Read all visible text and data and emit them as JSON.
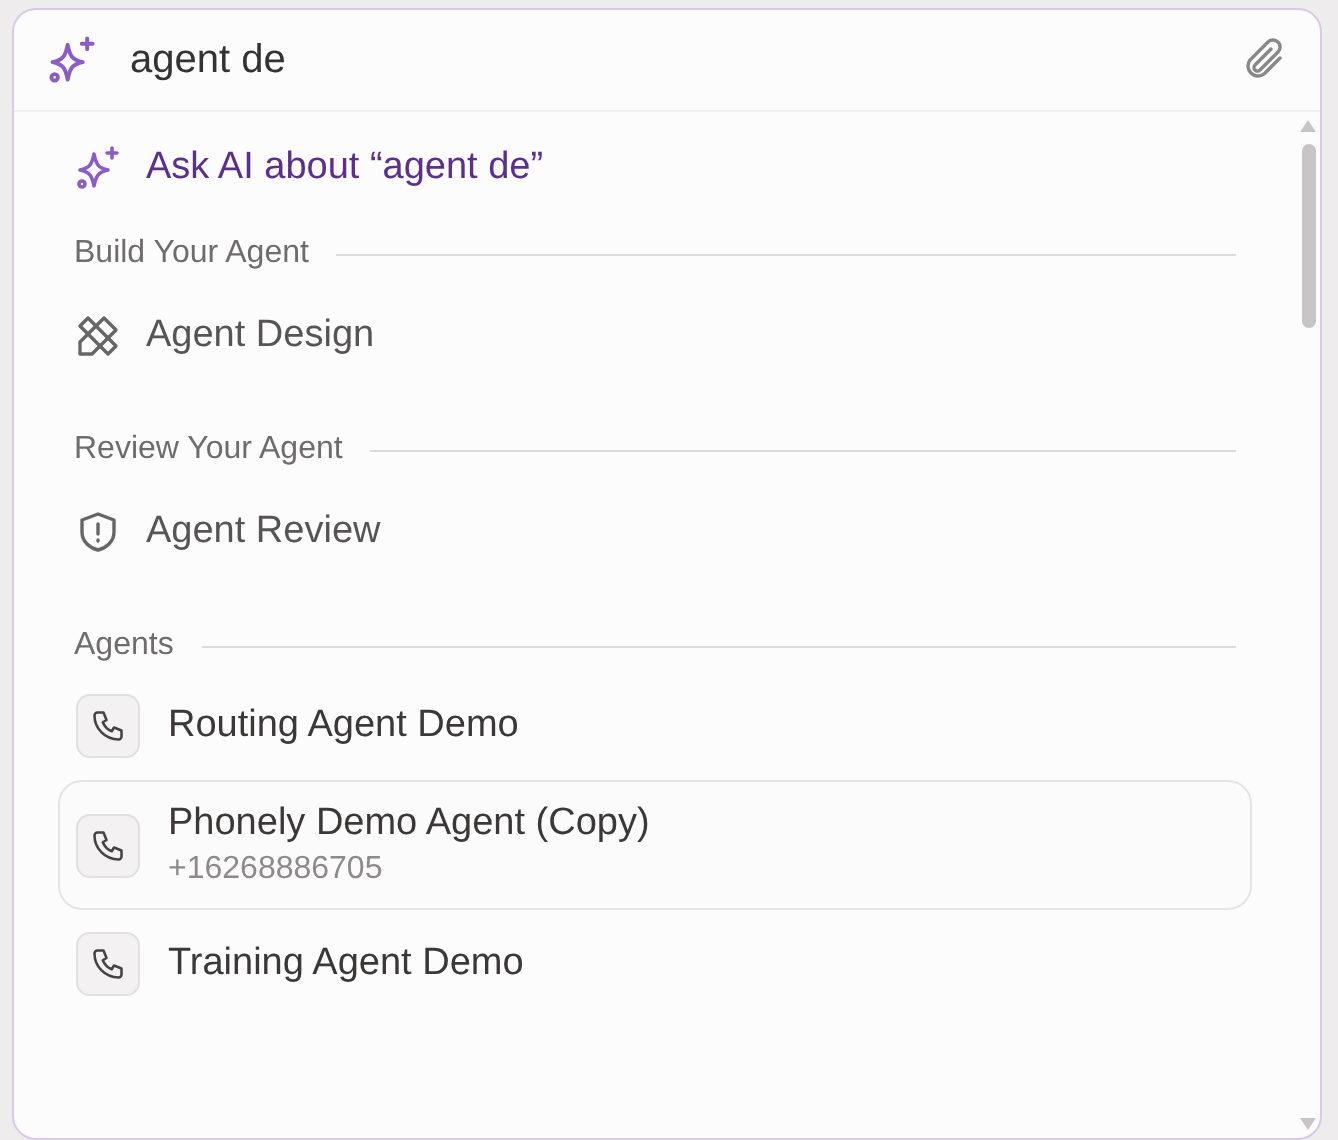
{
  "search": {
    "value": "agent de"
  },
  "ask_ai": {
    "label": "Ask AI about “agent de”"
  },
  "sections": [
    {
      "title": "Build Your Agent",
      "items": [
        {
          "kind": "design",
          "label": "Agent Design"
        }
      ]
    },
    {
      "title": "Review Your Agent",
      "items": [
        {
          "kind": "review",
          "label": "Agent Review"
        }
      ]
    }
  ],
  "agents": {
    "title": "Agents",
    "items": [
      {
        "name": "Routing Agent Demo",
        "selected": false
      },
      {
        "name": "Phonely Demo Agent (Copy)",
        "phone": "+16268886705",
        "selected": true
      },
      {
        "name": "Training Agent Demo",
        "selected": false
      }
    ]
  }
}
